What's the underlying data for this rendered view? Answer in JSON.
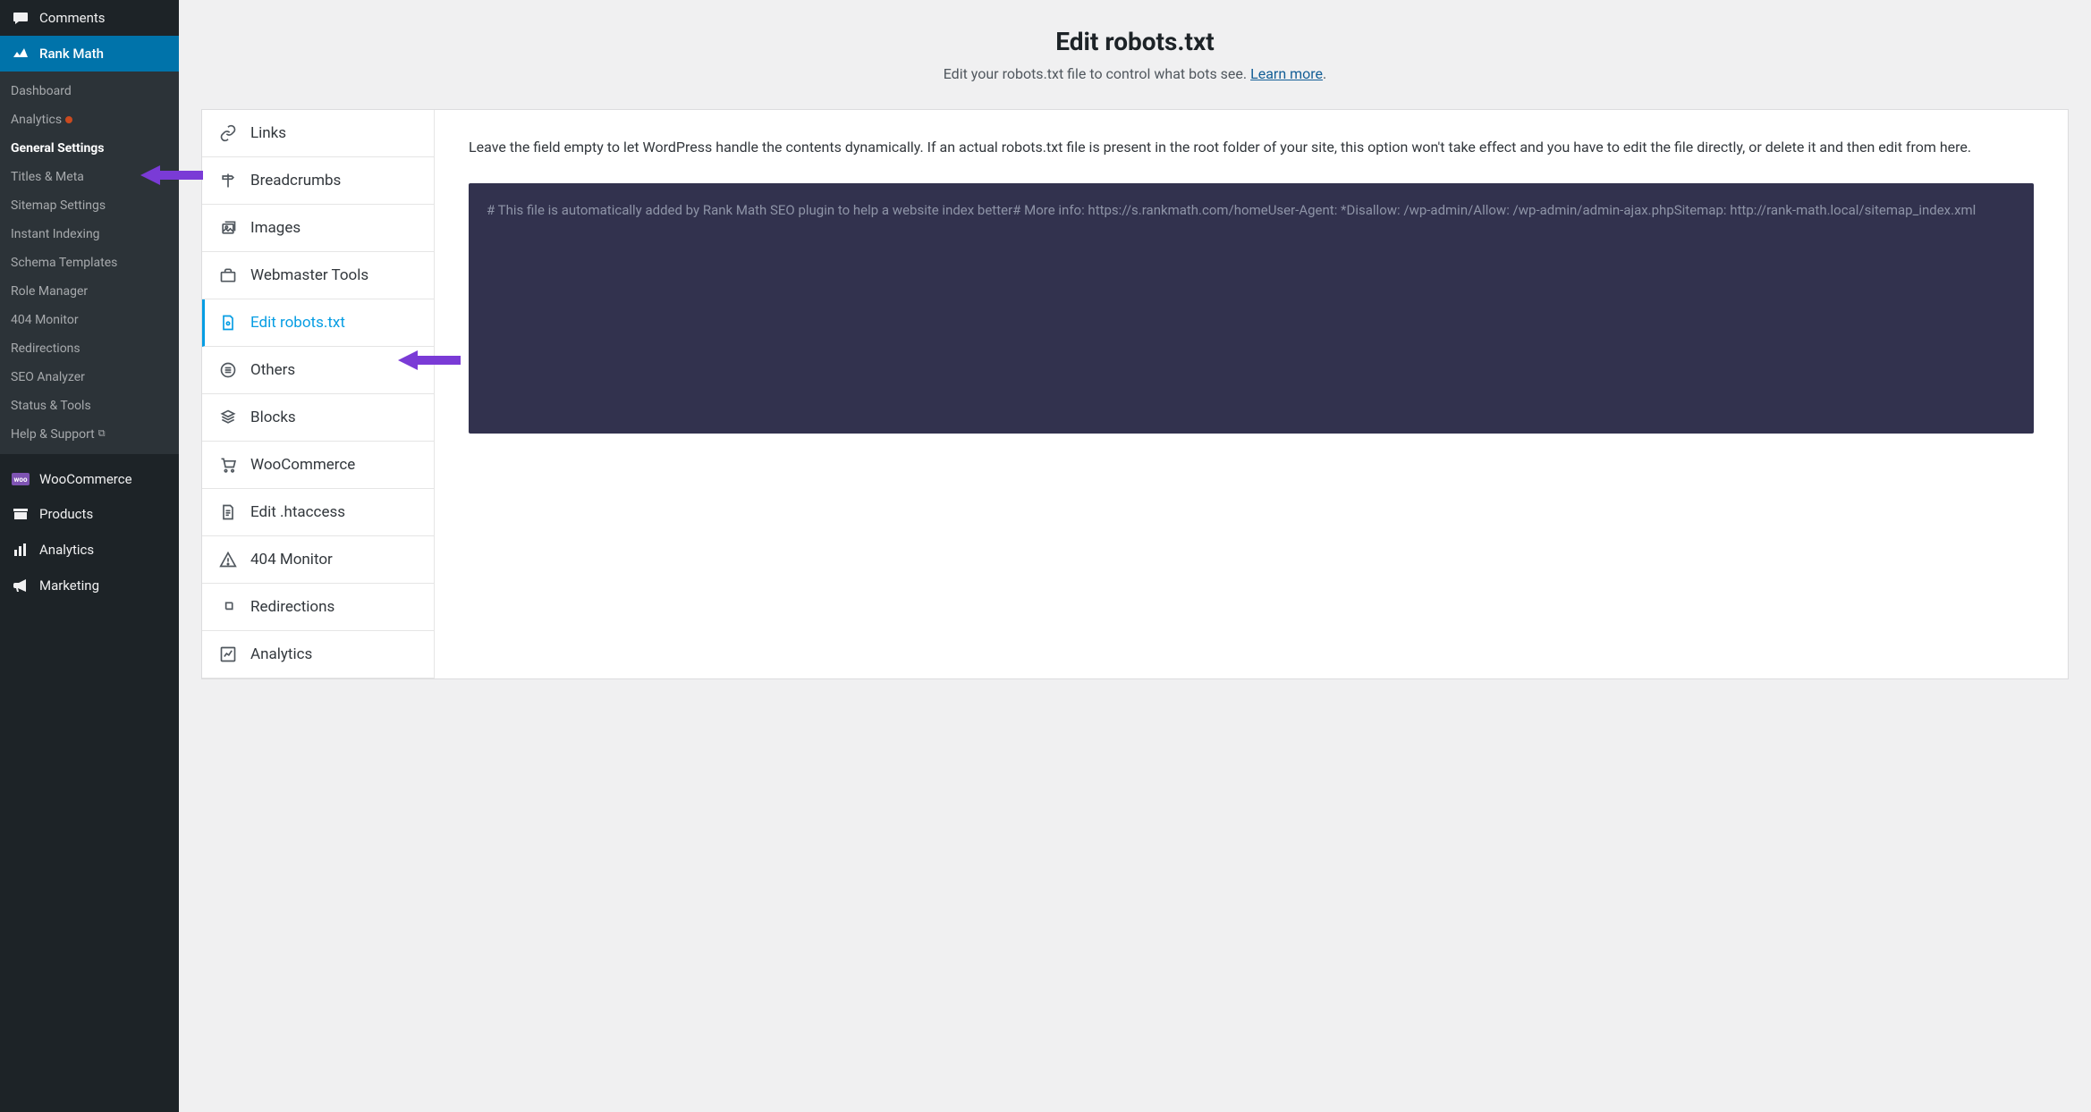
{
  "adminMenu": {
    "comments": "Comments",
    "rankMath": "Rank Math",
    "submenu": {
      "dashboard": "Dashboard",
      "analytics": "Analytics",
      "generalSettings": "General Settings",
      "titlesMeta": "Titles & Meta",
      "sitemapSettings": "Sitemap Settings",
      "instantIndexing": "Instant Indexing",
      "schemaTemplates": "Schema Templates",
      "roleManager": "Role Manager",
      "monitor404": "404 Monitor",
      "redirections": "Redirections",
      "seoAnalyzer": "SEO Analyzer",
      "statusTools": "Status & Tools",
      "helpSupport": "Help & Support"
    },
    "wooCommerce": "WooCommerce",
    "products": "Products",
    "analytics": "Analytics",
    "marketing": "Marketing"
  },
  "header": {
    "title": "Edit robots.txt",
    "subtitlePrefix": "Edit your robots.txt file to control what bots see. ",
    "learnMore": "Learn more",
    "subtitleSuffix": "."
  },
  "tabs": {
    "links": "Links",
    "breadcrumbs": "Breadcrumbs",
    "images": "Images",
    "webmasterTools": "Webmaster Tools",
    "editRobots": "Edit robots.txt",
    "others": "Others",
    "blocks": "Blocks",
    "wooCommerce": "WooCommerce",
    "editHtaccess": "Edit .htaccess",
    "monitor404": "404 Monitor",
    "redirections": "Redirections",
    "analytics": "Analytics"
  },
  "body": {
    "description": "Leave the field empty to let WordPress handle the contents dynamically. If an actual robots.txt file is present in the root folder of your site, this option won't take effect and you have to edit the file directly, or delete it and then edit from here.",
    "robotsContent": "# This file is automatically added by Rank Math SEO plugin to help a website index better# More info: https://s.rankmath.com/homeUser-Agent: *Disallow: /wp-admin/Allow: /wp-admin/admin-ajax.phpSitemap: http://rank-math.local/sitemap_index.xml"
  }
}
